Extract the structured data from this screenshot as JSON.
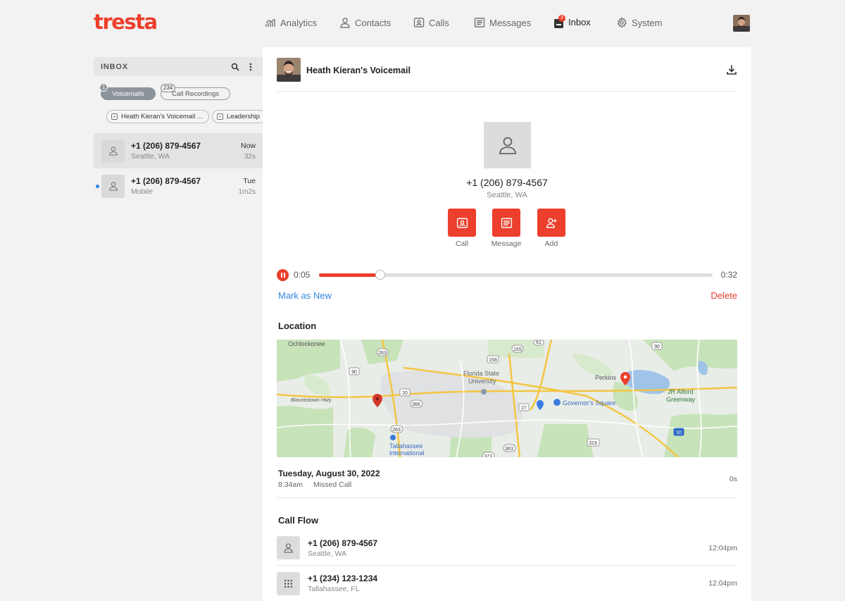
{
  "app": {
    "logo": "tresta"
  },
  "nav": {
    "analytics": "Analytics",
    "contacts": "Contacts",
    "calls": "Calls",
    "messages": "Messages",
    "inbox": "Inbox",
    "inbox_badge": "3",
    "system": "System"
  },
  "sidebar": {
    "title": "INBOX",
    "tabs": {
      "voicemails": {
        "label": "Voicemails",
        "count": "1"
      },
      "recordings": {
        "label": "Call Recordings",
        "count": "234"
      }
    },
    "filters": [
      "Heath Kieran's Voicemail ...",
      "Leadership"
    ],
    "items": [
      {
        "phone": "+1 (206) 879-4567",
        "sub": "Seattle, WA",
        "time": "Now",
        "duration": "32s"
      },
      {
        "phone": "+1 (206) 879-4567",
        "sub": "Mobile",
        "time": "Tue",
        "duration": "1m2s"
      }
    ]
  },
  "panel": {
    "title": "Heath Kieran's Voicemail",
    "contact": {
      "phone": "+1 (206) 879-4567",
      "city": "Seattle, WA"
    },
    "actions": {
      "call": "Call",
      "message": "Message",
      "add": "Add"
    },
    "player": {
      "current": "0:05",
      "total": "0:32",
      "progress": 0.156
    },
    "mark_new": "Mark as New",
    "delete": "Delete",
    "location_title": "Location",
    "map_labels": {
      "ochlockonee": "Ochlockonee",
      "fsu1": "Florida State",
      "fsu2": "University",
      "perkins": "Perkins",
      "alford1": "JR Alford",
      "alford2": "Greenway",
      "governors": "Governor's Square",
      "blountstown": "Blountstown Hwy",
      "airport1": "Tallahassee",
      "airport2": "International",
      "r263a": "263",
      "r90a": "90",
      "r158": "158",
      "r155": "155",
      "r61": "61",
      "r20": "20",
      "r366": "366",
      "r27": "27",
      "r263b": "263",
      "r363": "363",
      "r319": "319",
      "r373": "373",
      "r90b": "90",
      "r10": "10"
    },
    "date": {
      "main": "Tuesday, August 30, 2022",
      "time": "8:34am",
      "status": "Missed Call",
      "duration": "0s"
    },
    "flow_title": "Call Flow",
    "flow": [
      {
        "phone": "+1 (206) 879-4567",
        "sub": "Seattle, WA",
        "time": "12:04pm"
      },
      {
        "phone": "+1 (234) 123-1234",
        "sub": "Tallahassee, FL",
        "time": "12:04pm"
      }
    ]
  },
  "colors": {
    "brand": "#ec3f2c",
    "link": "#2e86de"
  }
}
